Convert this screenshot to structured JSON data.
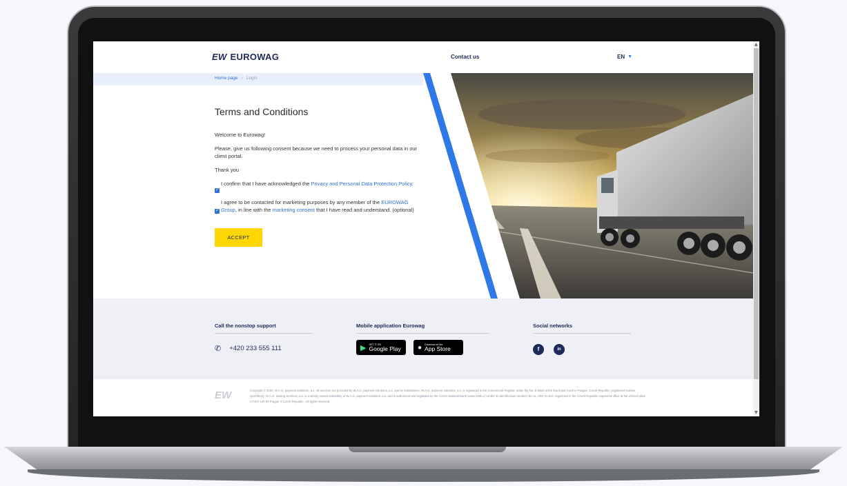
{
  "header": {
    "logo_mark": "EW",
    "logo_text": "EUROWAG",
    "contact_label": "Contact us",
    "language": "EN"
  },
  "breadcrumb": {
    "home": "Home page",
    "separator": "›",
    "current": "Login"
  },
  "terms": {
    "title": "Terms and Conditions",
    "welcome": "Welcome to Eurowag!",
    "consent_request": "Please, give us following consent because we need to process your personal data in our client portal.",
    "thanks": "Thank you",
    "privacy_prefix": "I confirm that I have acknowledged the ",
    "privacy_link": "Privacy and Personal Data Protection Policy",
    "privacy_suffix": ".",
    "marketing_prefix": "I agree to be contacted for marketing purposes by any member of the ",
    "marketing_group_link": "EUROWAG Group",
    "marketing_mid": ", in line with the ",
    "marketing_consent_link": "marketing consent",
    "marketing_suffix": " that I have read and understand. (optional)",
    "privacy_checked": true,
    "marketing_checked": true,
    "accept_label": "ACCEPT"
  },
  "footer": {
    "support_heading": "Call the nonstop support",
    "phone": "+420 233 555 111",
    "mobile_heading": "Mobile application Eurowag",
    "google_play_small": "GET IT ON",
    "google_play_big": "Google Play",
    "app_store_small": "Download on the",
    "app_store_big": "App Store",
    "social_heading": "Social networks",
    "social_facebook": "f",
    "social_linkedin": "in"
  },
  "copyright": {
    "logo": "EW",
    "text": "Copyright © 2020, W.A.G. payment solutions, a.s. All services are provided by W.A.G. payment solutions, a.s. and its subsidiaries. W.A.G. payment solutions, a.s. is registered in the Commercial Register under file No. B 6682 at the Municipal Court in Prague, Czech Republic (registered number 26415623). W.A.G. issuing Services, a.s. is a wholly owned subsidiary of W.A.G. payment solutions, a.s. and is authorized and regulated by the Czech National Bank (www.CNB.cz) under its identification number (ID no.) 050 21 910, registered in the Czech Republic registered office at Na Vítězné pláni 1719/4 140 00 Prague 4 Czech Republic . All rights reserved."
  },
  "colors": {
    "brand_navy": "#1d2a58",
    "accent_blue": "#2f78e8",
    "accept_yellow": "#ffd600"
  }
}
